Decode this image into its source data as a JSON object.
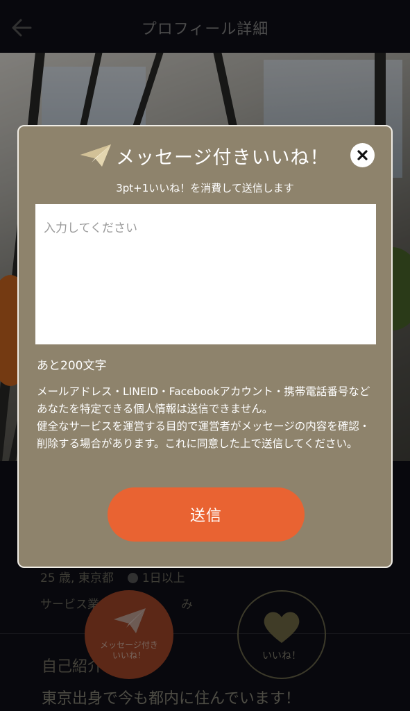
{
  "header": {
    "title": "プロフィール詳細"
  },
  "profile": {
    "meta": "25 歳, 東京都",
    "status": "1日以上",
    "job": "サービス業",
    "job_tail": "み",
    "intro_title": "自己紹介",
    "intro_text": "東京出身で今も都内に住んでいます！"
  },
  "actions": {
    "message_like_label": "メッセージ付き\nいいね！",
    "like_label": "いいね！"
  },
  "modal": {
    "title": "メッセージ付きいいね！",
    "subtitle": "3pt+1いいね！を消費して送信します",
    "input_placeholder": "入力してください",
    "input_value": "",
    "remaining": "あと200文字",
    "notice_1": "メールアドレス・LINEID・Facebookアカウント・携帯電話番号などあなたを特定できる個人情報は送信できません。",
    "notice_2": "健全なサービスを運営する目的で運営者がメッセージの内容を確認・削除する場合があります。これに同意した上で送信してください。",
    "send_label": "送信"
  },
  "colors": {
    "modal_bg": "#8e836c",
    "send_button": "#e96332",
    "icon_cream": "#efe2bf"
  },
  "icons": [
    "back-arrow-icon",
    "paper-plane-icon",
    "close-icon",
    "heart-icon"
  ]
}
